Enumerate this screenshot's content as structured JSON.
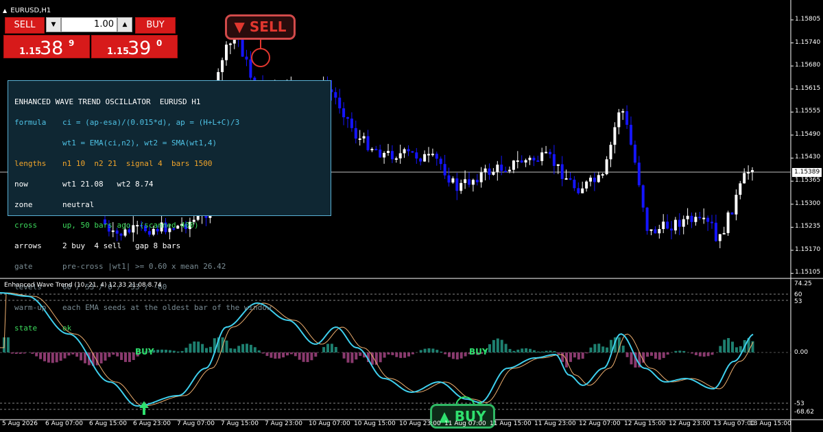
{
  "window": {
    "title": "EURUSD,H1"
  },
  "trade_panel": {
    "sell_label": "SELL",
    "buy_label": "BUY",
    "lot": "1.00",
    "sell_price": {
      "prefix": "1.15",
      "main": "38",
      "sup": "9"
    },
    "buy_price": {
      "prefix": "1.15",
      "main": "39",
      "sup": "0"
    }
  },
  "callouts": {
    "sell": "▼ SELL",
    "buy": "▲ BUY"
  },
  "info_panel": {
    "header": "ENHANCED WAVE TREND OSCILLATOR  EURUSD H1",
    "rows": [
      {
        "key": "formula",
        "value": "ci = (ap-esa)/(0.015*d), ap = (H+L+C)/3"
      },
      {
        "key": "",
        "value": "wt1 = EMA(ci,n2), wt2 = SMA(wt1,4)"
      },
      {
        "key": "lengths",
        "value": "n1 10  n2 21  signal 4  bars 1500"
      },
      {
        "key": "now",
        "value": "wt1 21.08   wt2 8.74"
      },
      {
        "key": "zone",
        "value": "neutral"
      },
      {
        "key": "cross",
        "value": "up, 50 bars ago  (scanned 400)"
      },
      {
        "key": "arrows",
        "value": "2 buy  4 sell   gap 8 bars"
      },
      {
        "key": "gate",
        "value": "pre-cross |wt1| >= 0.60 x mean 26.42"
      },
      {
        "key": "levels",
        "value": "60 / 53 / 0 / -53 / -60"
      },
      {
        "key": "warm-up",
        "value": "each EMA seeds at the oldest bar of the window"
      },
      {
        "key": "state",
        "value": "ok"
      }
    ]
  },
  "price_axis": {
    "labels": [
      "1.15805",
      "1.15740",
      "1.15680",
      "1.15615",
      "1.15555",
      "1.15490",
      "1.15430",
      "1.15365",
      "1.15300",
      "1.15235",
      "1.15170",
      "1.15105"
    ],
    "current": "1.15389"
  },
  "oscillator": {
    "title": "Enhanced Wave Trend (10, 21, 4) 12.33 21.08 8.74",
    "labels": [
      "74.25",
      "60",
      "53",
      "0.00",
      "-53",
      "-68.62"
    ],
    "buy_text_1": "BUY",
    "buy_text_2": "BUY"
  },
  "time_axis": [
    "5 Aug 2026",
    "6 Aug 07:00",
    "6 Aug 15:00",
    "6 Aug 23:00",
    "7 Aug 07:00",
    "7 Aug 15:00",
    "7 Aug 23:00",
    "10 Aug 07:00",
    "10 Aug 15:00",
    "10 Aug 23:00",
    "11 Aug 07:00",
    "11 Aug 15:00",
    "11 Aug 23:00",
    "12 Aug 07:00",
    "12 Aug 15:00",
    "12 Aug 23:00",
    "13 Aug 07:00",
    "13 Aug 15:00"
  ],
  "colors": {
    "bull": "#ffffff",
    "bear": "#1515ff",
    "wt1": "#3fd0ee",
    "wt2": "#f0b070",
    "hist_pos": "#1e8070",
    "hist_neg": "#8a3a6e",
    "sell": "#e2372f",
    "buy": "#2fe06e"
  }
}
